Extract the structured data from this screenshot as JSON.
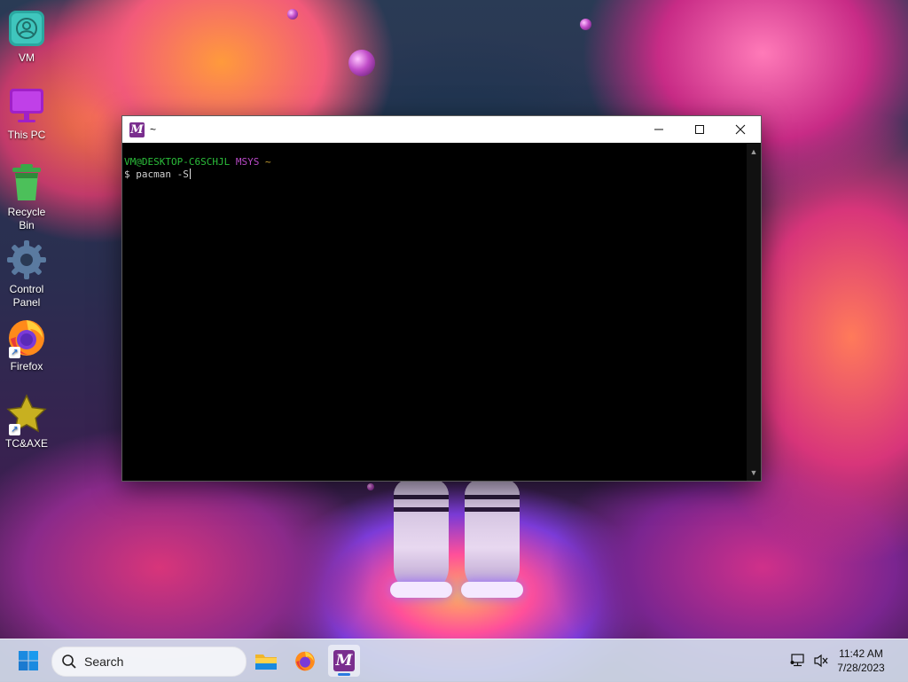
{
  "desktop": {
    "icons": [
      {
        "label": "VM",
        "icon": "user-folder-icon"
      },
      {
        "label": "This PC",
        "icon": "monitor-icon"
      },
      {
        "label": "Recycle Bin",
        "icon": "recycle-bin-icon"
      },
      {
        "label": "Control Panel",
        "icon": "gear-icon"
      },
      {
        "label": "Firefox",
        "icon": "firefox-icon",
        "shortcut": true
      },
      {
        "label": "TC&AXE",
        "icon": "star-icon",
        "shortcut": true
      }
    ]
  },
  "window": {
    "title": "~",
    "app_icon_glyph": "M",
    "accent": "#7a2e8e",
    "terminal": {
      "prompt_user": "VM@DESKTOP-C6SCHJL",
      "prompt_system": "MSYS",
      "prompt_path": "~",
      "command_prefix": "$",
      "command": "pacman -S"
    }
  },
  "taskbar": {
    "search_placeholder": "Search",
    "apps": [
      "start-icon",
      "file-explorer-icon",
      "firefox-icon",
      "msys2-icon"
    ],
    "active_app": "msys2-icon",
    "clock": {
      "time": "11:42 AM",
      "date": "7/28/2023"
    }
  }
}
